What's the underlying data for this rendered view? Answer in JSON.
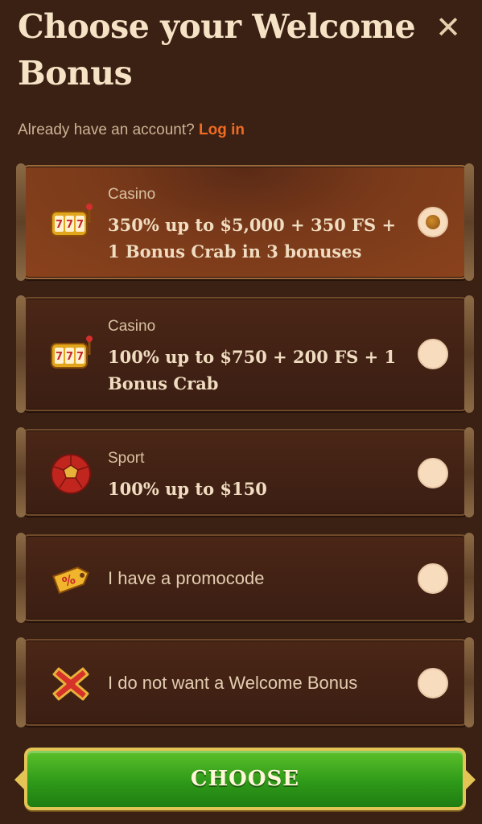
{
  "header": {
    "title": "Choose your Welcome Bonus",
    "close_symbol": "✕",
    "account_text": "Already have an account?",
    "login_label": "Log in"
  },
  "options": [
    {
      "category": "Casino",
      "offer": "350% up to $5,000 + 350 FS + 1 Bonus Crab in 3 bonuses",
      "icon": "slot-machine-icon",
      "selected": true
    },
    {
      "category": "Casino",
      "offer": "100% up to $750 + 200 FS + 1 Bonus Crab",
      "icon": "slot-machine-icon",
      "selected": false
    },
    {
      "category": "Sport",
      "offer": "100% up to $150",
      "icon": "soccer-ball-icon",
      "selected": false
    },
    {
      "label": "I have a promocode",
      "icon": "promo-tag-icon",
      "selected": false
    },
    {
      "label": "I do not want a Welcome Bonus",
      "icon": "red-x-icon",
      "selected": false
    }
  ],
  "cta": {
    "label": "CHOOSE"
  },
  "colors": {
    "background": "#3a2114",
    "accent": "#f26b21",
    "button": "#2f9a19",
    "button_border": "#e3c454"
  }
}
